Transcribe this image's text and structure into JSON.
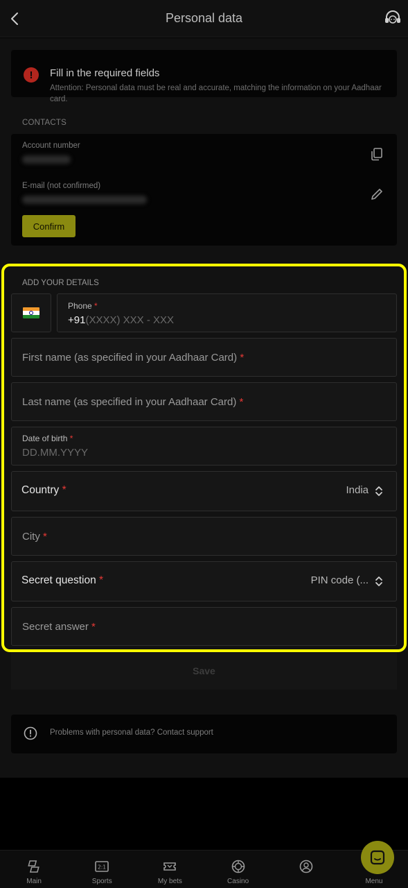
{
  "header": {
    "title": "Personal data"
  },
  "alert": {
    "title": "Fill in the required fields",
    "text": "Attention: Personal data must be real and accurate, matching the information on your Aadhaar card."
  },
  "contacts": {
    "section_label": "CONTACTS",
    "account_label": "Account number",
    "email_label": "E-mail (not confirmed)",
    "confirm_label": "Confirm"
  },
  "details": {
    "section_label": "ADD YOUR DETAILS",
    "phone": {
      "label": "Phone",
      "required": "*",
      "prefix": "+91",
      "mask": "(XXXX) XXX - XXX"
    },
    "first_name": {
      "placeholder": "First name (as specified in your Aadhaar Card)",
      "required": "*"
    },
    "last_name": {
      "placeholder": "Last name (as specified in your Aadhaar Card)",
      "required": "*"
    },
    "dob": {
      "label": "Date of birth",
      "required": "*",
      "placeholder": "DD.MM.YYYY"
    },
    "country": {
      "label": "Country",
      "required": "*",
      "value": "India"
    },
    "city": {
      "placeholder": "City",
      "required": "*"
    },
    "secret_question": {
      "label": "Secret question",
      "required": "*",
      "value": "PIN code (..."
    },
    "secret_answer": {
      "placeholder": "Secret answer",
      "required": "*"
    }
  },
  "save_label": "Save",
  "help_text": "Problems with personal data? Contact support",
  "tabbar": [
    {
      "label": "Main",
      "icon": "main-icon"
    },
    {
      "label": "Sports",
      "icon": "sports-icon"
    },
    {
      "label": "My bets",
      "icon": "ticket-icon"
    },
    {
      "label": "Casino",
      "icon": "casino-chip-icon"
    },
    {
      "label": "",
      "icon": "account-icon"
    },
    {
      "label": "Menu",
      "icon": "menu-icon"
    }
  ],
  "colors": {
    "accent": "#8a8a10",
    "highlight": "#ffff00",
    "required": "#e53935",
    "alert": "#b3261e"
  }
}
